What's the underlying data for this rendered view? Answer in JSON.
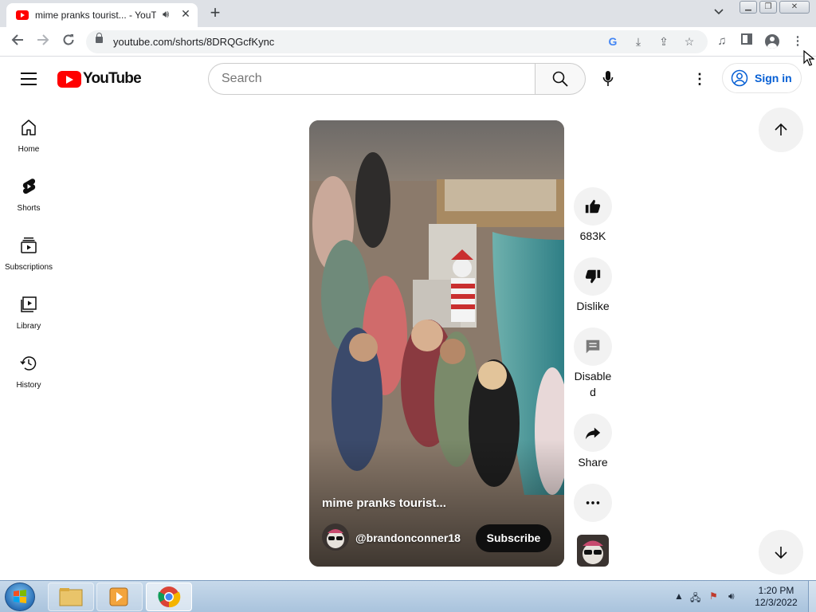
{
  "browser": {
    "tab_title": "mime pranks tourist... - YouTube",
    "url": "youtube.com/shorts/8DRQGcfKync"
  },
  "youtube": {
    "logo_text": "YouTube",
    "search_placeholder": "Search",
    "signin_label": "Sign in",
    "guide": [
      {
        "label": "Home",
        "icon": "home-icon"
      },
      {
        "label": "Shorts",
        "icon": "shorts-icon"
      },
      {
        "label": "Subscriptions",
        "icon": "subscriptions-icon"
      },
      {
        "label": "Library",
        "icon": "library-icon"
      },
      {
        "label": "History",
        "icon": "history-icon"
      }
    ]
  },
  "short": {
    "title": "mime pranks tourist...",
    "channel": "@brandonconner18",
    "subscribe_label": "Subscribe",
    "likes": "683K",
    "dislike_label": "Dislike",
    "comments_label": "Disabled",
    "share_label": "Share"
  },
  "taskbar": {
    "time": "1:20 PM",
    "date": "12/3/2022"
  },
  "colors": {
    "youtube_red": "#ff0000",
    "link_blue": "#065fd4",
    "action_bg": "#f2f2f2"
  }
}
